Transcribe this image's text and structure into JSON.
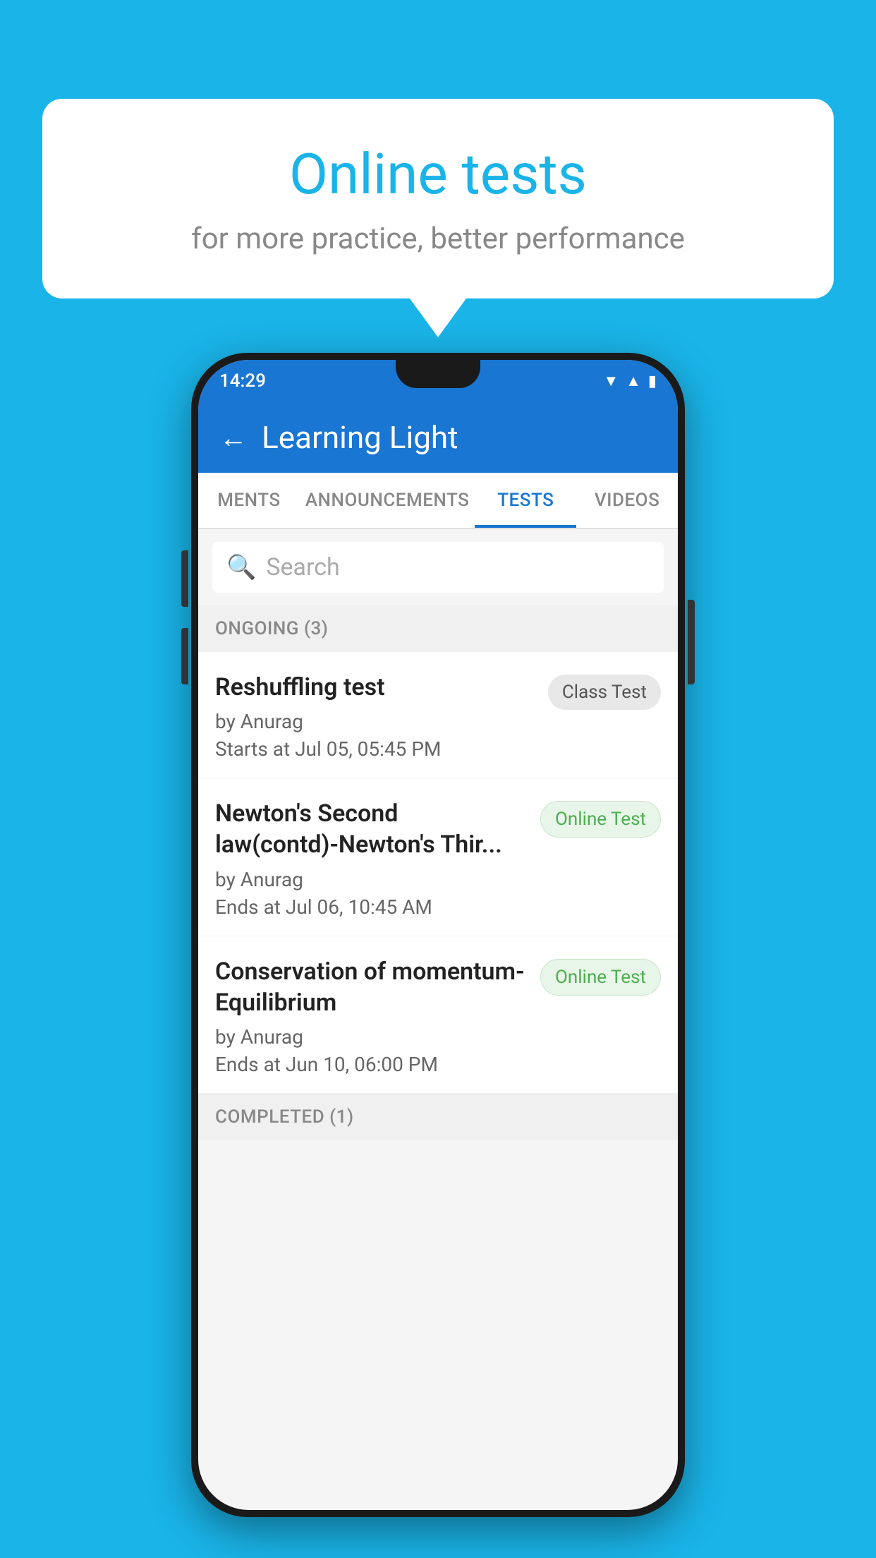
{
  "background_color": "#1ab4e8",
  "speech_bubble": {
    "title": "Online tests",
    "subtitle": "for more practice, better performance"
  },
  "phone": {
    "status_bar": {
      "time": "14:29",
      "icons": [
        "▼",
        "▲",
        "▮"
      ]
    },
    "app_bar": {
      "back_label": "←",
      "title": "Learning Light"
    },
    "tabs": [
      {
        "label": "MENTS",
        "active": false
      },
      {
        "label": "ANNOUNCEMENTS",
        "active": false
      },
      {
        "label": "TESTS",
        "active": true
      },
      {
        "label": "VIDEOS",
        "active": false
      }
    ],
    "search": {
      "placeholder": "Search",
      "icon": "🔍"
    },
    "sections": [
      {
        "label": "ONGOING (3)",
        "items": [
          {
            "name": "Reshuffling test",
            "author": "by Anurag",
            "date": "Starts at  Jul 05, 05:45 PM",
            "badge": "Class Test",
            "badge_type": "class"
          },
          {
            "name": "Newton's Second law(contd)-Newton's Thir...",
            "author": "by Anurag",
            "date": "Ends at  Jul 06, 10:45 AM",
            "badge": "Online Test",
            "badge_type": "online"
          },
          {
            "name": "Conservation of momentum-Equilibrium",
            "author": "by Anurag",
            "date": "Ends at  Jun 10, 06:00 PM",
            "badge": "Online Test",
            "badge_type": "online"
          }
        ]
      },
      {
        "label": "COMPLETED (1)",
        "items": []
      }
    ]
  }
}
